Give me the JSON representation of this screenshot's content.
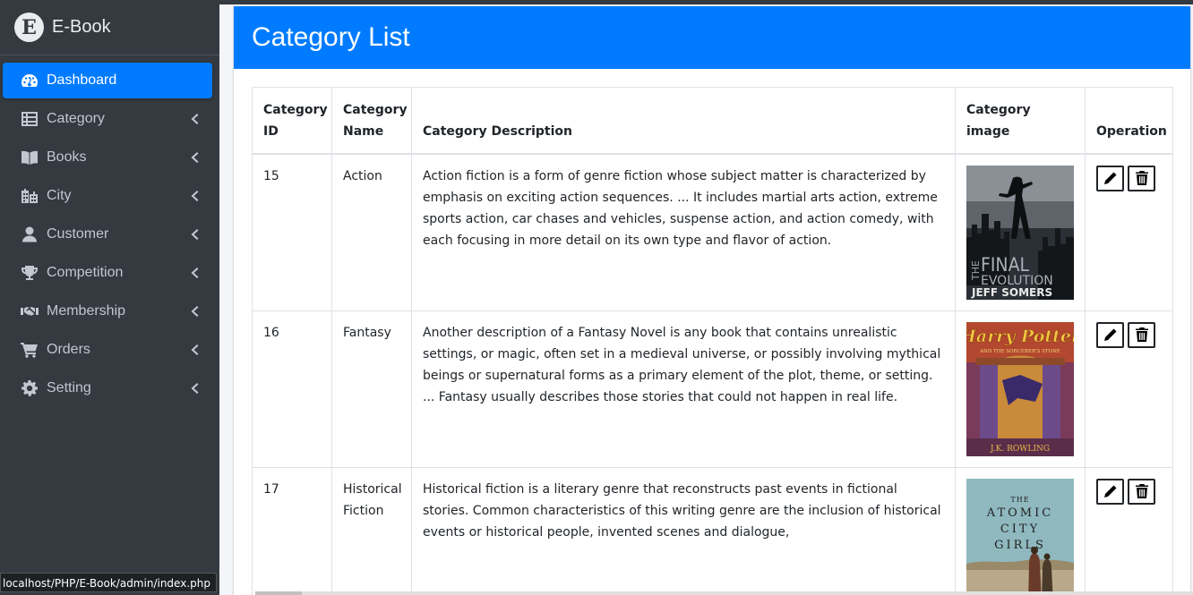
{
  "brand": {
    "logo_letter": "E",
    "name": "E-Book"
  },
  "sidebar": {
    "items": [
      {
        "label": "Dashboard",
        "icon": "tachometer-icon",
        "active": true
      },
      {
        "label": "Category",
        "icon": "list-icon",
        "active": false
      },
      {
        "label": "Books",
        "icon": "book-open-icon",
        "active": false
      },
      {
        "label": "City",
        "icon": "city-icon",
        "active": false
      },
      {
        "label": "Customer",
        "icon": "user-icon",
        "active": false
      },
      {
        "label": "Competition",
        "icon": "trophy-icon",
        "active": false
      },
      {
        "label": "Membership",
        "icon": "handshake-icon",
        "active": false
      },
      {
        "label": "Orders",
        "icon": "cart-icon",
        "active": false
      },
      {
        "label": "Setting",
        "icon": "gear-icon",
        "active": false
      }
    ]
  },
  "page": {
    "title": "Category List"
  },
  "table": {
    "headers": [
      "Category ID",
      "Category Name",
      "Category Description",
      "Category image",
      "Operation"
    ],
    "rows": [
      {
        "id": "15",
        "name": "Action",
        "description": "Action fiction is a form of genre fiction whose subject matter is characterized by emphasis on exciting action sequences. ... It includes martial arts action, extreme sports action, car chases and vehicles, suspense action, and action comedy, with each focusing in more detail on its own type and flavor of action.",
        "image": {
          "line1": "THE",
          "line2": "FINAL",
          "line3": "EVOLUTION",
          "author": "JEFF SOMERS"
        }
      },
      {
        "id": "16",
        "name": "Fantasy",
        "description": "Another description of a Fantasy Novel is any book that contains unrealistic settings, or magic, often set in a medieval universe, or possibly involving mythical beings or supernatural forms as a primary element of the plot, theme, or setting. ... Fantasy usually describes those stories that could not happen in real life.",
        "image": {
          "title": "Harry Potter",
          "subtitle": "AND THE SORCERER'S STONE",
          "author": "J.K. ROWLING"
        }
      },
      {
        "id": "17",
        "name": "Historical Fiction",
        "description": "Historical fiction is a literary genre that reconstructs past events in fictional stories. Common characteristics of this writing genre are the inclusion of historical events or historical people, invented scenes and dialogue,",
        "image": {
          "line1": "THE",
          "line2": "ATOMIC",
          "line3": "CITY",
          "line4": "GIRLS"
        }
      }
    ]
  },
  "statusbar": {
    "url": "localhost/PHP/E-Book/admin/index.php"
  },
  "colors": {
    "sidebar_bg": "#343a40",
    "accent": "#007bff",
    "sidebar_text": "#c2c7d0"
  }
}
